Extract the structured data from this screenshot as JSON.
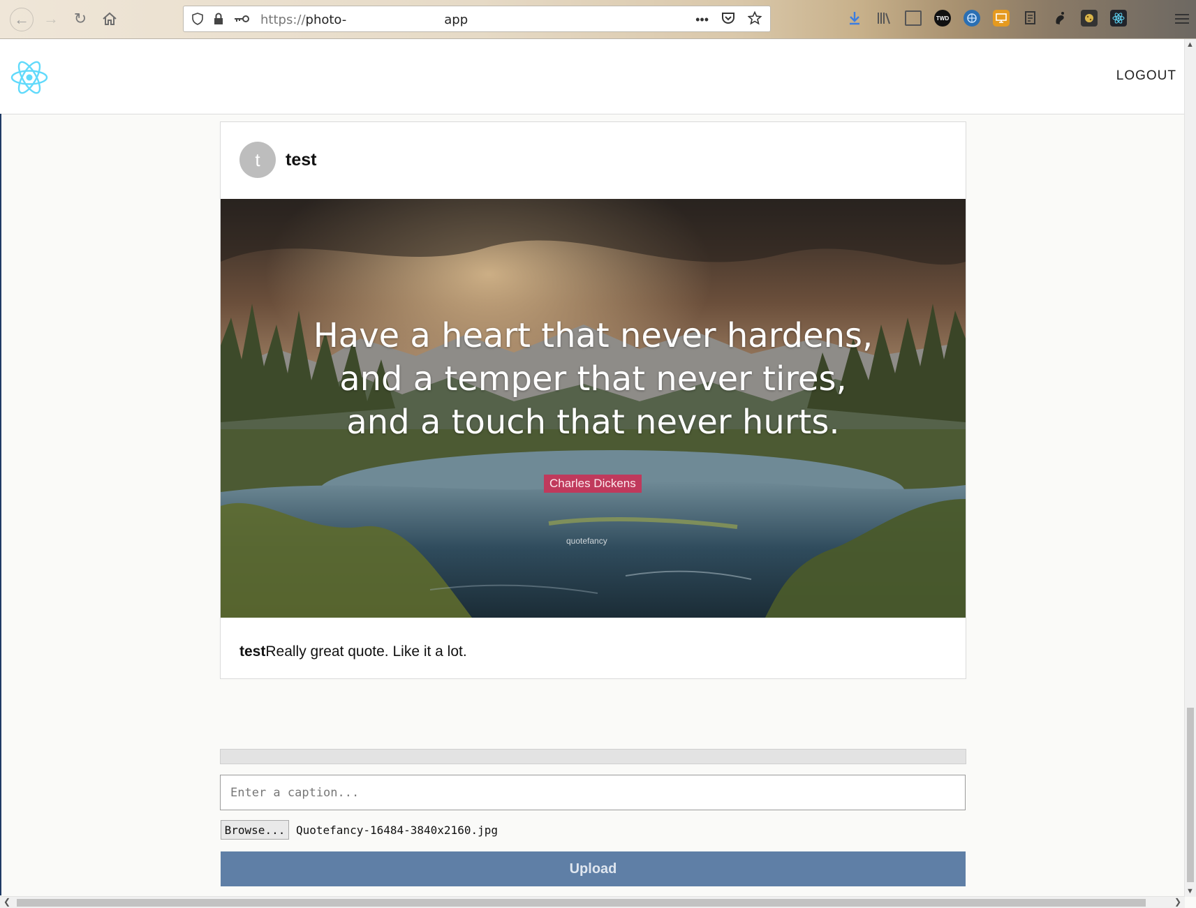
{
  "browser": {
    "url_scheme": "https://",
    "url_host": "photo-",
    "url_suffix": "app",
    "page_actions_label": "•••"
  },
  "app": {
    "logout_label": "LOGOUT"
  },
  "post": {
    "avatar_initial": "t",
    "username": "test",
    "image": {
      "quote_lines": [
        "Have a heart that never hardens,",
        "and a temper that never tires,",
        "and a touch that never hurts."
      ],
      "author": "Charles Dickens",
      "watermark": "quotefancy"
    },
    "caption_user": "test",
    "caption_text": "Really great quote. Like it a lot."
  },
  "upload": {
    "progress_fraction": 0,
    "caption_placeholder": "Enter a caption...",
    "browse_label": "Browse...",
    "file_name": "Quotefancy-16484-3840x2160.jpg",
    "upload_label": "Upload"
  },
  "colors": {
    "upload_button": "#5f7fa6",
    "author_tag": "#c0395c",
    "react_logo": "#61dafb"
  },
  "icons": {
    "logo": "react-atom-icon",
    "avatar": "avatar-initial"
  }
}
